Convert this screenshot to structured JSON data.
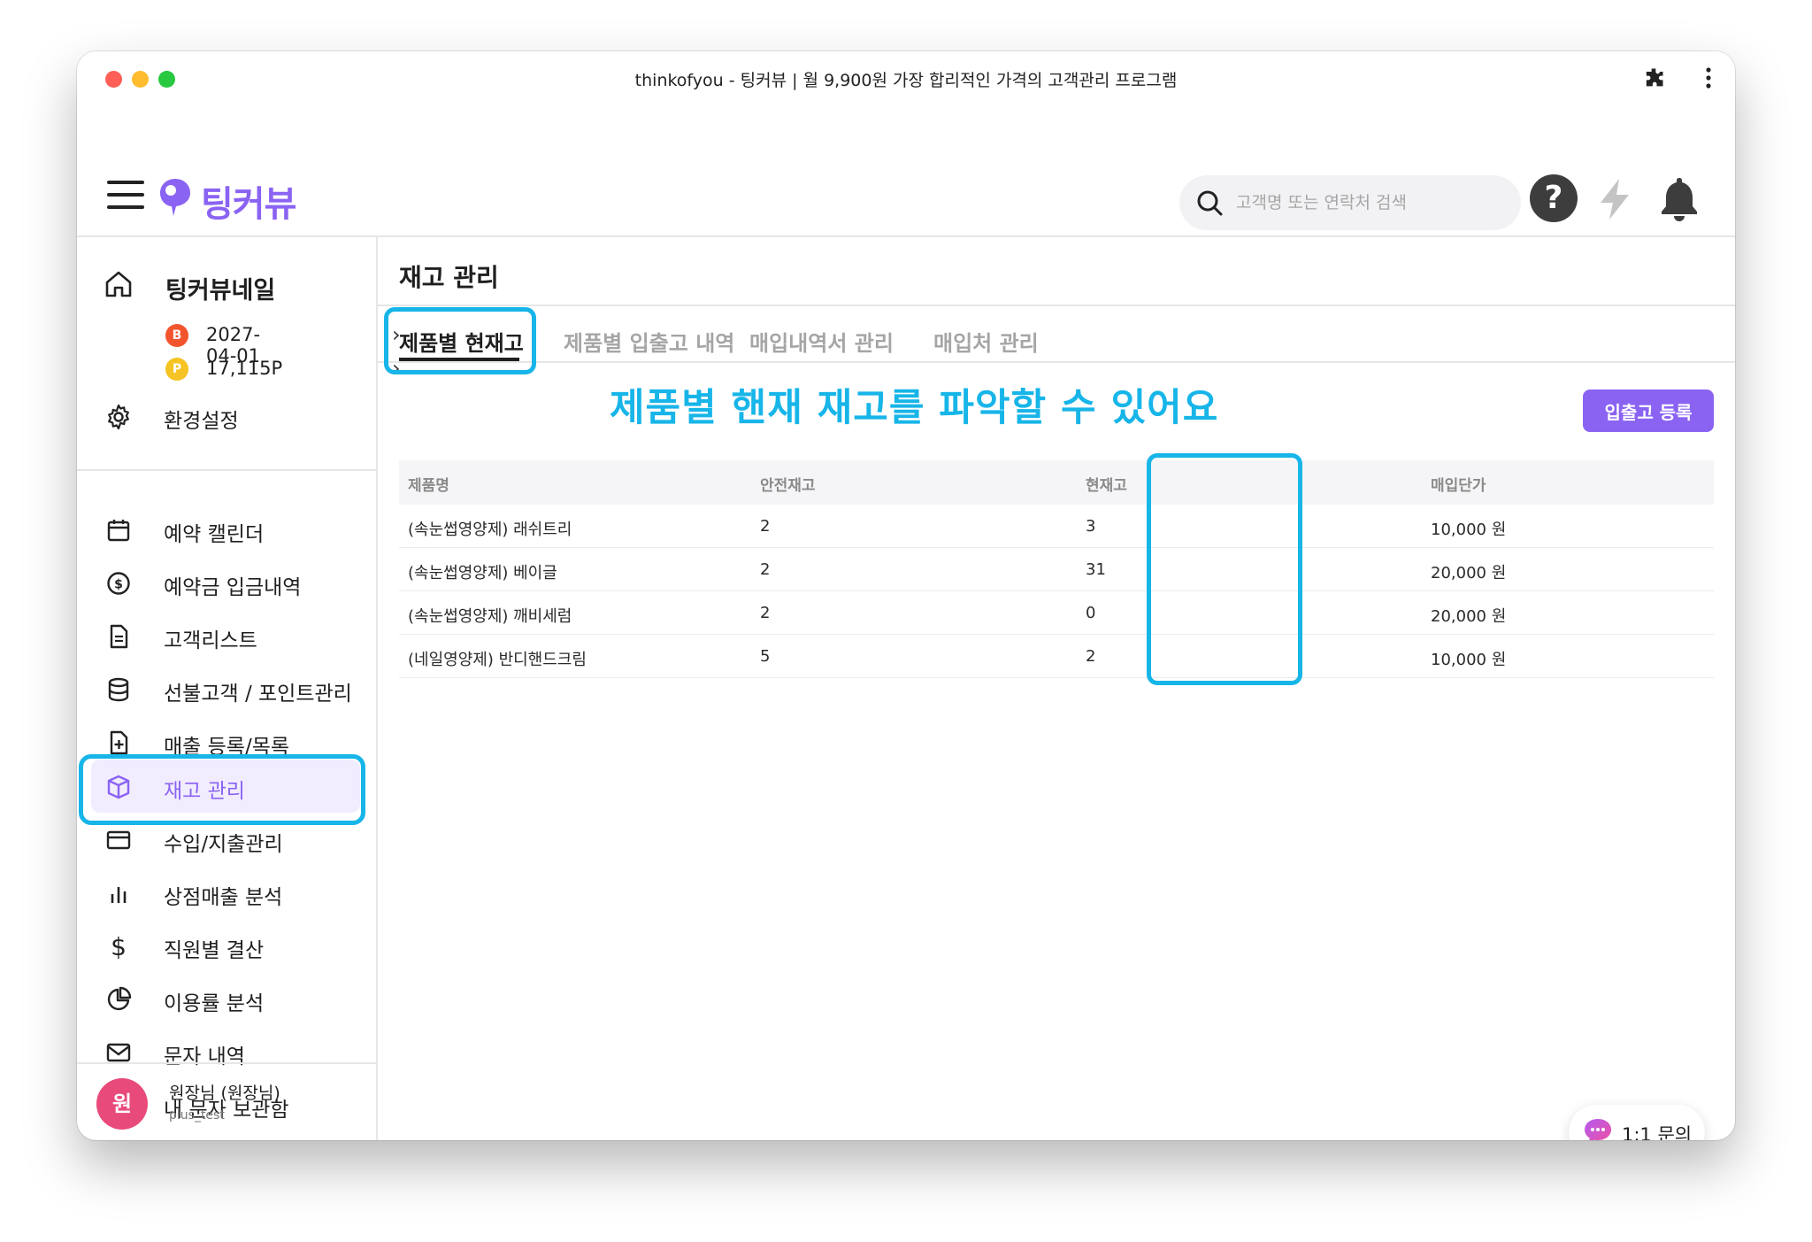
{
  "window": {
    "title": "thinkofyou - 팅커뷰 | 월 9,900원 가장 합리적인 가격의 고객관리 프로그램"
  },
  "header": {
    "logo_text": "팅커뷰",
    "search_placeholder": "고객명 또는 연락처 검색",
    "help_label": "?"
  },
  "sidebar": {
    "shop_name": "팅커뷰네일",
    "expiry_badge": "B",
    "expiry_date": "2027-04-01",
    "points_badge": "P",
    "points": "17,115P",
    "settings_label": "환경설정",
    "items": [
      {
        "label": "예약 캘린더",
        "icon": "calendar-icon"
      },
      {
        "label": "예약금 입금내역",
        "icon": "dollar-circle-icon"
      },
      {
        "label": "고객리스트",
        "icon": "document-icon"
      },
      {
        "label": "선불고객 / 포인트관리",
        "icon": "database-icon"
      },
      {
        "label": "매출 등록/목록",
        "icon": "file-plus-icon"
      },
      {
        "label": "재고 관리",
        "icon": "box-icon",
        "active": true
      },
      {
        "label": "수입/지출관리",
        "icon": "credit-card-icon"
      },
      {
        "label": "상점매출 분석",
        "icon": "bar-chart-icon"
      },
      {
        "label": "직원별 결산",
        "icon": "dollar-sign-icon"
      },
      {
        "label": "이용률 분석",
        "icon": "pie-chart-icon"
      },
      {
        "label": "문자 내역",
        "icon": "mail-icon"
      },
      {
        "label": "내 문자 보관함",
        "icon": "archive-icon"
      }
    ],
    "user": {
      "avatar_text": "원",
      "name": "원장님 (원장님)",
      "id": "plus_test"
    }
  },
  "main": {
    "page_title": "재고 관리",
    "tabs": [
      {
        "label": "제품별 현재고",
        "active": true
      },
      {
        "label": "제품별 입출고 내역"
      },
      {
        "label": "매입내역서 관리"
      },
      {
        "label": "매입처 관리"
      }
    ],
    "banner": "제품별 핸재 재고를 파악할 수 있어요",
    "register_button": "입출고 등록",
    "table": {
      "headers": [
        "제품명",
        "안전재고",
        "현재고",
        "매입단가"
      ],
      "rows": [
        [
          "(속눈썹영양제) 래쉬트리",
          "2",
          "3",
          "10,000 원"
        ],
        [
          "(속눈썹영양제) 베이글",
          "2",
          "31",
          "20,000 원"
        ],
        [
          "(속눈썹영양제) 깨비세럼",
          "2",
          "0",
          "20,000 원"
        ],
        [
          "(네일영양제) 반디핸드크림",
          "5",
          "2",
          "10,000 원"
        ]
      ]
    }
  },
  "inquiry": {
    "label": "1:1 문의"
  },
  "colors": {
    "brand": "#8a63f3",
    "highlight": "#17b5e8",
    "active_bg": "#f1ecfe"
  }
}
